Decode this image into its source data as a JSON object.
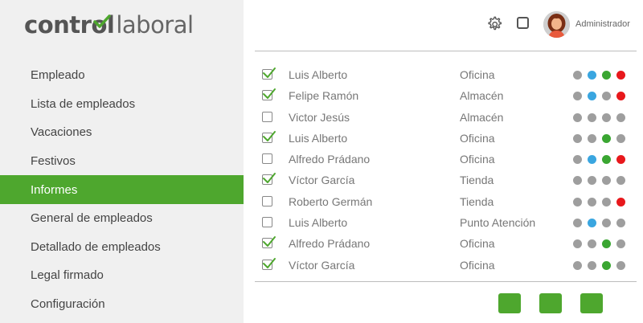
{
  "logo": {
    "part1": "contr",
    "part2": "l",
    "part3": "laboral"
  },
  "sidebar": {
    "items": [
      {
        "label": "Empleado",
        "active": false
      },
      {
        "label": "Lista de empleados",
        "active": false
      },
      {
        "label": "Vacaciones",
        "active": false
      },
      {
        "label": "Festivos",
        "active": false
      },
      {
        "label": "Informes",
        "active": true
      },
      {
        "label": "General de empleados",
        "active": false
      },
      {
        "label": "Detallado de empleados",
        "active": false
      },
      {
        "label": "Legal firmado",
        "active": false
      },
      {
        "label": "Configuración",
        "active": false
      }
    ]
  },
  "header": {
    "user_name": "Administrador",
    "icons": [
      "gear-icon",
      "square-icon",
      "avatar"
    ]
  },
  "colors": {
    "accent": "#4ea72e",
    "dot_gray": "#9e9e9e",
    "dot_blue": "#3aa6e0",
    "dot_green": "#3aa632",
    "dot_red": "#e8181c"
  },
  "rows": [
    {
      "checked": true,
      "name": "Luis Alberto",
      "location": "Oficina",
      "dots": [
        "gray",
        "blue",
        "green",
        "red"
      ]
    },
    {
      "checked": true,
      "name": "Felipe Ramón",
      "location": "Almacén",
      "dots": [
        "gray",
        "blue",
        "gray",
        "red"
      ]
    },
    {
      "checked": false,
      "name": "Victor Jesús",
      "location": "Almacén",
      "dots": [
        "gray",
        "gray",
        "gray",
        "gray"
      ]
    },
    {
      "checked": true,
      "name": "Luis Alberto",
      "location": "Oficina",
      "dots": [
        "gray",
        "gray",
        "green",
        "gray"
      ]
    },
    {
      "checked": false,
      "name": "Alfredo Prádano",
      "location": "Oficina",
      "dots": [
        "gray",
        "blue",
        "green",
        "red"
      ]
    },
    {
      "checked": true,
      "name": "Víctor García",
      "location": "Tienda",
      "dots": [
        "gray",
        "gray",
        "gray",
        "gray"
      ]
    },
    {
      "checked": false,
      "name": "Roberto Germán",
      "location": "Tienda",
      "dots": [
        "gray",
        "gray",
        "gray",
        "red"
      ]
    },
    {
      "checked": false,
      "name": "Luis Alberto",
      "location": "Punto Atención",
      "dots": [
        "gray",
        "blue",
        "gray",
        "gray"
      ]
    },
    {
      "checked": true,
      "name": "Alfredo Prádano",
      "location": "Oficina",
      "dots": [
        "gray",
        "gray",
        "green",
        "gray"
      ]
    },
    {
      "checked": true,
      "name": "Víctor García",
      "location": "Oficina",
      "dots": [
        "gray",
        "gray",
        "green",
        "gray"
      ]
    }
  ],
  "footer_buttons": [
    {
      "label": ""
    },
    {
      "label": ""
    },
    {
      "label": ""
    }
  ]
}
